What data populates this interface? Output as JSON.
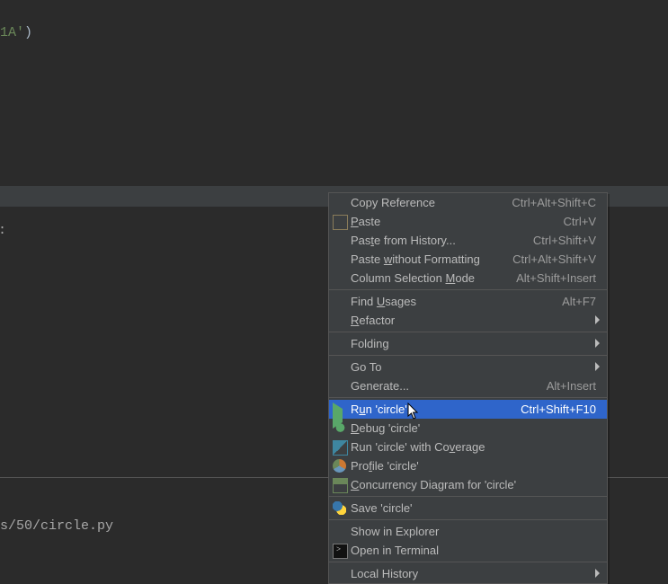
{
  "editor": {
    "code_fragment_string": "1A'",
    "code_fragment_paren": ")"
  },
  "panel": {
    "colon": ":"
  },
  "status": {
    "path": "s/50/circle.py"
  },
  "context_menu": {
    "items": [
      {
        "label_pre": "Copy Reference",
        "mn": "",
        "label_post": "",
        "shortcut": "Ctrl+Alt+Shift+C",
        "icon": "",
        "sub": false
      },
      {
        "label_pre": "",
        "mn": "P",
        "label_post": "aste",
        "shortcut": "Ctrl+V",
        "icon": "paste",
        "sub": false
      },
      {
        "label_pre": "Pas",
        "mn": "t",
        "label_post": "e from History...",
        "shortcut": "Ctrl+Shift+V",
        "icon": "",
        "sub": false
      },
      {
        "label_pre": "Paste ",
        "mn": "w",
        "label_post": "ithout Formatting",
        "shortcut": "Ctrl+Alt+Shift+V",
        "icon": "",
        "sub": false
      },
      {
        "label_pre": "Column Selection ",
        "mn": "M",
        "label_post": "ode",
        "shortcut": "Alt+Shift+Insert",
        "icon": "",
        "sub": false
      },
      {
        "sep": true
      },
      {
        "label_pre": "Find ",
        "mn": "U",
        "label_post": "sages",
        "shortcut": "Alt+F7",
        "icon": "",
        "sub": false
      },
      {
        "label_pre": "",
        "mn": "R",
        "label_post": "efactor",
        "shortcut": "",
        "icon": "",
        "sub": true
      },
      {
        "sep": true
      },
      {
        "label_pre": "Folding",
        "mn": "",
        "label_post": "",
        "shortcut": "",
        "icon": "",
        "sub": true
      },
      {
        "sep": true
      },
      {
        "label_pre": "Go To",
        "mn": "",
        "label_post": "",
        "shortcut": "",
        "icon": "",
        "sub": true
      },
      {
        "label_pre": "Generate...",
        "mn": "",
        "label_post": "",
        "shortcut": "Alt+Insert",
        "icon": "",
        "sub": false
      },
      {
        "sep": true
      },
      {
        "label_pre": "R",
        "mn": "u",
        "label_post": "n 'circle'",
        "shortcut": "Ctrl+Shift+F10",
        "icon": "run",
        "sub": false,
        "highlight": true
      },
      {
        "label_pre": "",
        "mn": "D",
        "label_post": "ebug 'circle'",
        "shortcut": "",
        "icon": "debug",
        "sub": false
      },
      {
        "label_pre": "Run 'circle' with Co",
        "mn": "v",
        "label_post": "erage",
        "shortcut": "",
        "icon": "cover",
        "sub": false
      },
      {
        "label_pre": "Pro",
        "mn": "f",
        "label_post": "ile 'circle'",
        "shortcut": "",
        "icon": "profile",
        "sub": false
      },
      {
        "label_pre": "",
        "mn": "C",
        "label_post": "oncurrency Diagram for 'circle'",
        "shortcut": "",
        "icon": "concur",
        "sub": false
      },
      {
        "sep": true
      },
      {
        "label_pre": "Save 'circle'",
        "mn": "",
        "label_post": "",
        "shortcut": "",
        "icon": "python",
        "sub": false
      },
      {
        "sep": true
      },
      {
        "label_pre": "Show in Explorer",
        "mn": "",
        "label_post": "",
        "shortcut": "",
        "icon": "",
        "sub": false
      },
      {
        "label_pre": "Open in Terminal",
        "mn": "",
        "label_post": "",
        "shortcut": "",
        "icon": "term",
        "sub": false
      },
      {
        "sep": true
      },
      {
        "label_pre": "Local History",
        "mn": "",
        "label_post": "",
        "shortcut": "",
        "icon": "",
        "sub": true
      }
    ]
  }
}
